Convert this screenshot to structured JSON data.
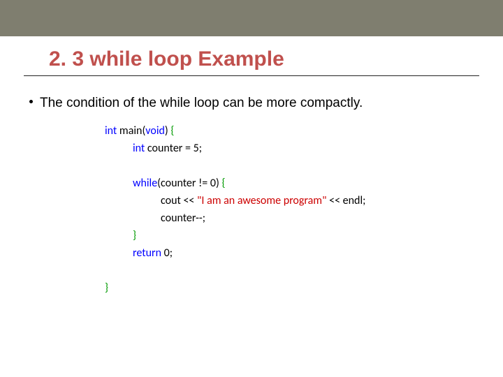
{
  "title": "2. 3 while loop  Example",
  "bullet": "The condition of the while loop can be more compactly.",
  "code": {
    "l1a": "int",
    "l1b": " main(",
    "l1c": "void",
    "l1d": ") ",
    "l1e": "{",
    "l2a": "int",
    "l2b": " counter = 5;",
    "l3a": "while",
    "l3b": "(counter != 0) ",
    "l3c": "{",
    "l4a": "cout << ",
    "l4b": "\"I am an awesome program\"",
    "l4c": " << endl;",
    "l5": "counter--;",
    "l6": "}",
    "l7a": "return",
    "l7b": " 0;",
    "l8": "}"
  }
}
